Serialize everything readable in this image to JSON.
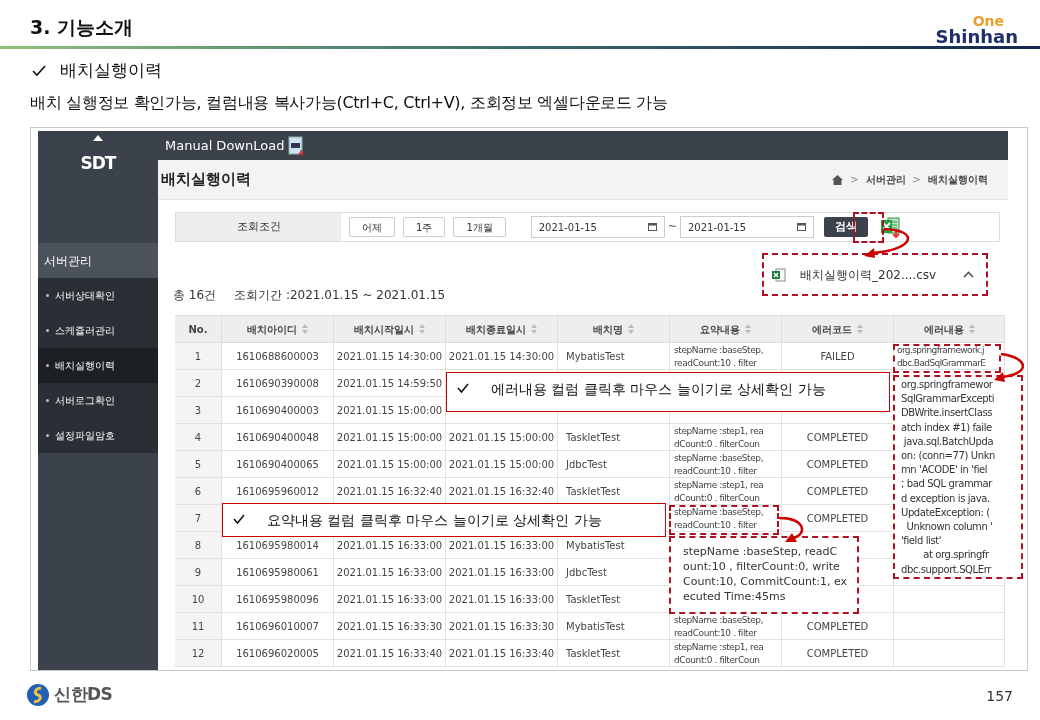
{
  "slide": {
    "title": "3. 기능소개",
    "logo_top": "One",
    "logo_bottom": "Shinhan",
    "bullet": "배치실행이력",
    "description": "배치 실행정보 확인가능, 컬럼내용 복사가능(Ctrl+C, Ctrl+V), 조회정보 엑셀다운로드 가능",
    "footer_brand": "신한DS",
    "page_number": "157"
  },
  "app": {
    "brand": "SDT",
    "manual": "Manual DownLoad",
    "section": "서버관리",
    "sidebar_items": [
      {
        "label": "서버상태확인",
        "selected": false
      },
      {
        "label": "스케쥴러관리",
        "selected": false
      },
      {
        "label": "배치실행이력",
        "selected": true
      },
      {
        "label": "서버로그확인",
        "selected": false
      },
      {
        "label": "설정파일암호",
        "selected": false
      }
    ],
    "page_title": "배치실행이력",
    "breadcrumb": [
      ">",
      "서버관리",
      ">",
      "배치실행이력"
    ],
    "search": {
      "label": "조회조건",
      "quick_buttons": [
        "어제",
        "1주",
        "1개월"
      ],
      "date_from": "2021-01-15",
      "separator": "~",
      "date_to": "2021-01-15",
      "search_button": "검색"
    },
    "download": {
      "file": "배치실행이력_202....csv"
    },
    "summary": {
      "count": "총 16건",
      "period": "조회기간 :2021.01.15 ~ 2021.01.15"
    },
    "table": {
      "columns": [
        {
          "label": "No.",
          "sortable": false
        },
        {
          "label": "배치아이디",
          "sortable": true
        },
        {
          "label": "배치시작일시",
          "sortable": true
        },
        {
          "label": "배치종료일시",
          "sortable": true
        },
        {
          "label": "배치명",
          "sortable": true
        },
        {
          "label": "요약내용",
          "sortable": true
        },
        {
          "label": "에러코드",
          "sortable": true
        },
        {
          "label": "에러내용",
          "sortable": true
        }
      ],
      "rows": [
        {
          "no": "1",
          "batch_id": "1610688600003",
          "start": "2021.01.15 14:30:00",
          "end": "2021.01.15 14:30:00",
          "name": "MybatisTest",
          "summary": [
            "stepName :baseStep,",
            "readCount:10 . filter"
          ],
          "error_code": "FAILED",
          "error_detail": [
            "org.springframework.j",
            "dbc.BadSqlGrammarE"
          ]
        },
        {
          "no": "2",
          "batch_id": "1610690390008",
          "start": "2021.01.15 14:59:50"
        },
        {
          "no": "3",
          "batch_id": "1610690400003",
          "start": "2021.01.15 15:00:00"
        },
        {
          "no": "4",
          "batch_id": "1610690400048",
          "start": "2021.01.15 15:00:00",
          "end": "2021.01.15 15:00:00",
          "name": "TaskletTest",
          "summary": [
            "stepName :step1, rea",
            "dCount:0 . filterCoun"
          ],
          "error_code": "COMPLETED"
        },
        {
          "no": "5",
          "batch_id": "1610690400065",
          "start": "2021.01.15 15:00:00",
          "end": "2021.01.15 15:00:00",
          "name": "JdbcTest",
          "summary": [
            "stepName :baseStep,",
            "readCount:10 . filter"
          ],
          "error_code": "COMPLETED"
        },
        {
          "no": "6",
          "batch_id": "1610695960012",
          "start": "2021.01.15 16:32:40",
          "end": "2021.01.15 16:32:40",
          "name": "TaskletTest",
          "summary": [
            "stepName :step1, rea",
            "dCount:0 . filterCoun"
          ],
          "error_code": "COMPLETED"
        },
        {
          "no": "7",
          "summary": [
            "stepName :baseStep,",
            "readCount:10 . filter"
          ],
          "error_code": "COMPLETED"
        },
        {
          "no": "8",
          "batch_id": "1610695980014",
          "start": "2021.01.15 16:33:00",
          "end": "2021.01.15 16:33:00",
          "name": "MybatisTest"
        },
        {
          "no": "9",
          "batch_id": "1610695980061",
          "start": "2021.01.15 16:33:00",
          "end": "2021.01.15 16:33:00",
          "name": "JdbcTest"
        },
        {
          "no": "10",
          "batch_id": "1610695980096",
          "start": "2021.01.15 16:33:00",
          "end": "2021.01.15 16:33:00",
          "name": "TaskletTest"
        },
        {
          "no": "11",
          "batch_id": "1610696010007",
          "start": "2021.01.15 16:33:30",
          "end": "2021.01.15 16:33:30",
          "name": "MybatisTest",
          "summary": [
            "stepName :baseStep,",
            "readCount:10 . filter"
          ],
          "error_code": "COMPLETED"
        },
        {
          "no": "12",
          "batch_id": "1610696020005",
          "start": "2021.01.15 16:33:40",
          "end": "2021.01.15 16:33:40",
          "name": "TaskletTest",
          "summary": [
            "stepName :step1, rea",
            "dCount:0 . filterCoun"
          ],
          "error_code": "COMPLETED"
        }
      ]
    }
  },
  "callouts": [
    {
      "text": "에러내용 컬럼 클릭후 마우스 늘이기로 상세확인 가능"
    },
    {
      "text": "요약내용 컬럼 클릭후 마우스 늘이기로 상세확인 가능"
    }
  ],
  "summary_tooltip": [
    "stepName :baseStep, readC",
    "ount:10 , filterCount:0, write",
    "Count:10, CommitCount:1, ex",
    "ecuted Time:45ms"
  ],
  "error_tooltip": [
    "org.springframewor",
    "SqlGrammarExcepti",
    "DBWrite.insertClass",
    "atch index #1) faile",
    " java.sql.BatchUpda",
    "on: (conn=77) Unkn",
    "mn 'ACODE' in 'fiel",
    "; bad SQL grammar",
    "d exception is java.",
    "UpdateException: (",
    "  Unknown column '",
    "'field list'",
    "        at org.springfr",
    "dbc.support.SQLErr"
  ]
}
